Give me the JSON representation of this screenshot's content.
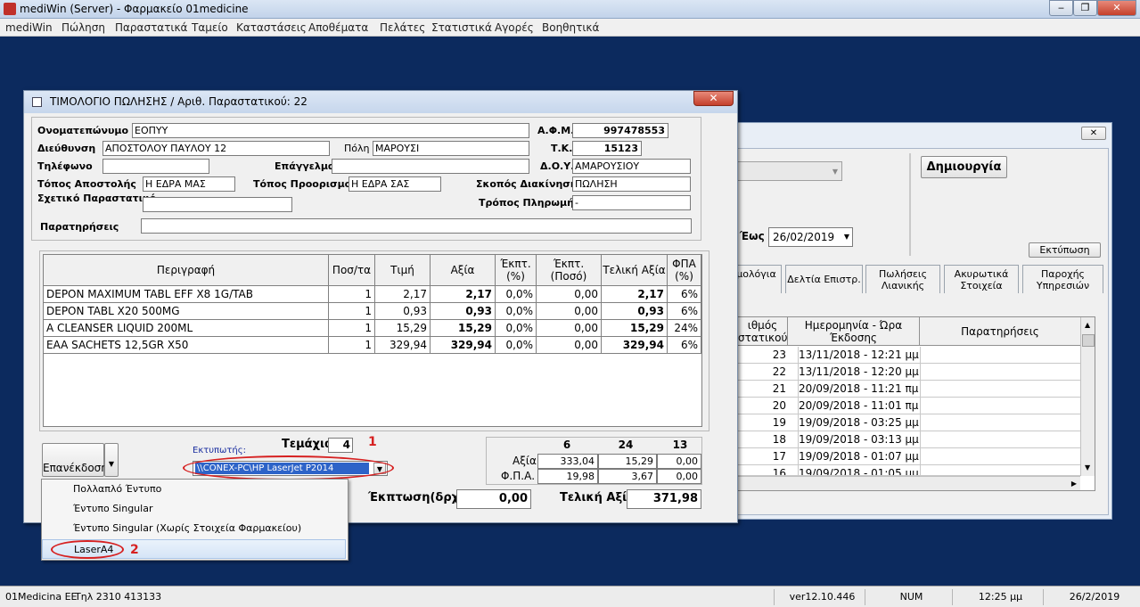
{
  "app": {
    "title": "mediWin (Server) - Φαρμακείο 01medicine"
  },
  "window_buttons": {
    "minimize": "‒",
    "maximize": "❐",
    "close": "✕"
  },
  "menu": [
    "mediWin",
    "Πώληση",
    "Παραστατικά",
    "Ταμείο",
    "Καταστάσεις",
    "Αποθέματα",
    "Πελάτες",
    "Στατιστικά",
    "Αγορές",
    "Βοηθητικά"
  ],
  "status": {
    "company": "01Medicina ΕΕ",
    "phone": "Τηλ 2310 413133",
    "version": "ver12.10.446",
    "num": "NUM",
    "time": "12:25 μμ",
    "date": "26/2/2019"
  },
  "back": {
    "create_btn": "Δημιουργία",
    "to_label": "Έως",
    "to_date": "26/02/2019",
    "print_btn": "Εκτύπωση",
    "close_btn": "✕",
    "tabs": [
      "μολόγια",
      "Δελτία Επιστρ.",
      "Πωλήσεις Λιανικής",
      "Ακυρωτικά Στοιχεία",
      "Παροχής Υπηρεσιών"
    ],
    "grid_headers": [
      "ιθμός στατικού",
      "Ημερομηνία - Ώρα Έκδοσης",
      "Παρατηρήσεις"
    ],
    "rows": [
      {
        "num": "23",
        "dt": "13/11/2018 - 12:21 μμ"
      },
      {
        "num": "22",
        "dt": "13/11/2018 - 12:20 μμ"
      },
      {
        "num": "21",
        "dt": "20/09/2018 - 11:21 πμ"
      },
      {
        "num": "20",
        "dt": "20/09/2018 - 11:01 πμ"
      },
      {
        "num": "19",
        "dt": "19/09/2018 - 03:25 μμ"
      },
      {
        "num": "18",
        "dt": "19/09/2018 - 03:13 μμ"
      },
      {
        "num": "17",
        "dt": "19/09/2018 - 01:07 μμ"
      },
      {
        "num": "16",
        "dt": "19/09/2018 - 01:05 μμ"
      }
    ]
  },
  "dialog": {
    "title": "ΤΙΜΟΛΟΓΙΟ ΠΩΛΗΣΗΣ / Αριθ. Παραστατικού: 22",
    "close": "✕",
    "labels": {
      "name": "Ονοματεπώνυμο",
      "address": "Διεύθυνση",
      "phone": "Τηλέφωνο",
      "ship_from": "Τόπος Αποστολής",
      "related": "Σχετικό Παραστατικό",
      "notes": "Παρατηρήσεις",
      "city": "Πόλη",
      "profession": "Επάγγελμα",
      "ship_to": "Τόπος Προορισμού",
      "afm": "Α.Φ.Μ.",
      "tk": "Τ.Κ.",
      "doy": "Δ.Ο.Υ.",
      "purpose": "Σκοπός Διακίνησης",
      "payment": "Τρόπος Πληρωμής"
    },
    "values": {
      "name": "ΕΟΠΥΥ",
      "address": "ΑΠΟΣΤΟΛΟΥ ΠΑΥΛΟΥ 12",
      "phone": "",
      "ship_from": "Η ΕΔΡΑ ΜΑΣ",
      "related": "",
      "notes": "",
      "city": "ΜΑΡΟΥΣΙ",
      "profession": "",
      "ship_to": "Η ΕΔΡΑ ΣΑΣ",
      "afm": "997478553",
      "tk": "15123",
      "doy": "ΑΜΑΡΟΥΣΙΟΥ",
      "purpose": "ΠΩΛΗΣΗ",
      "payment": "-"
    },
    "table_headers": [
      "Περιγραφή",
      "Ποσ/τα",
      "Τιμή",
      "Αξία",
      "Έκπτ. (%)",
      "Έκπτ. (Ποσό)",
      "Τελική Αξία",
      "ΦΠΑ (%)"
    ],
    "items": [
      [
        "DEPON MAXIMUM TABL EFF X8 1G/TAB",
        "1",
        "2,17",
        "2,17",
        "0,0%",
        "0,00",
        "2,17",
        "6%"
      ],
      [
        "DEPON TABL X20 500MG",
        "1",
        "0,93",
        "0,93",
        "0,0%",
        "0,00",
        "0,93",
        "6%"
      ],
      [
        "A CLEANSER LIQUID 200ML",
        "1",
        "15,29",
        "15,29",
        "0,0%",
        "0,00",
        "15,29",
        "24%"
      ],
      [
        "EAA SACHETS 12,5GR X50",
        "1",
        "329,94",
        "329,94",
        "0,0%",
        "0,00",
        "329,94",
        "6%"
      ]
    ],
    "reissue_btn": "Επανέκδοση",
    "printer_label": "Εκτυπωτής:",
    "printer_value": "\\\\CONEX-PC\\HP LaserJet P2014",
    "pieces_label": "Τεμάχια",
    "pieces_value": "4",
    "vat_cols": [
      "6",
      "24",
      "13"
    ],
    "value_label": "Αξία",
    "vat_label": "Φ.Π.Α.",
    "values_row": [
      "333,04",
      "15,29",
      "0,00"
    ],
    "vat_row": [
      "19,98",
      "3,67",
      "0,00"
    ],
    "discount_label": "Έκπτωση(δρχ)",
    "discount_value": "0,00",
    "total_label": "Τελική Αξία",
    "total_value": "371,98"
  },
  "popup": [
    "Πολλαπλό Έντυπο",
    "Έντυπο Singular",
    "Έντυπο Singular  (Χωρίς Στοιχεία Φαρμακείου)",
    "LaserA4"
  ],
  "annotations": {
    "one": "1",
    "two": "2",
    "color": "#d62020"
  }
}
